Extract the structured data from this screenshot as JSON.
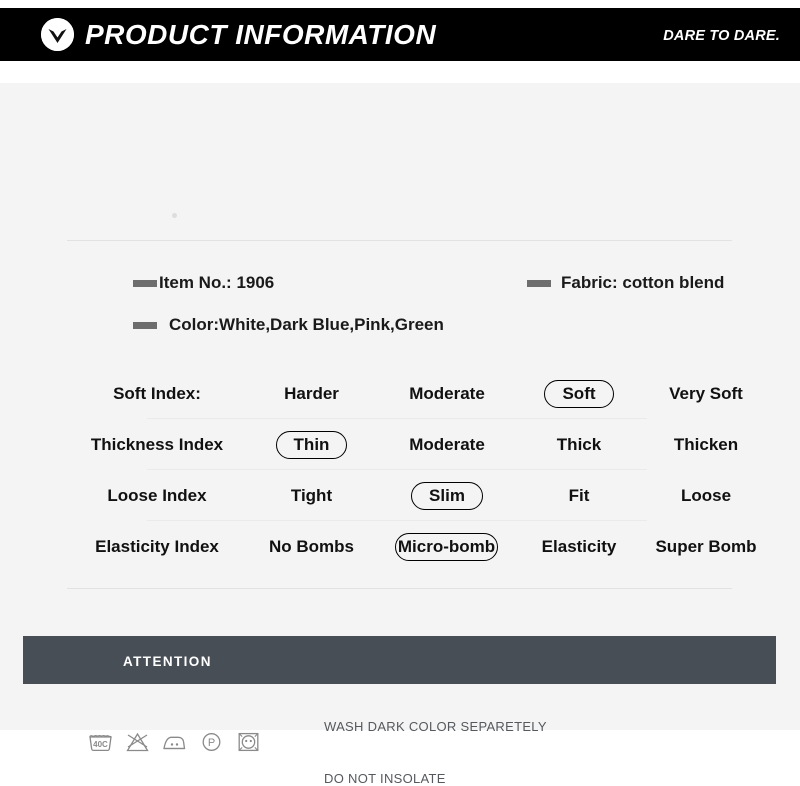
{
  "header": {
    "title": "PRODUCT INFORMATION",
    "tagline": "DARE TO DARE.",
    "logo_icon": "v-chevron-logo-icon",
    "background_color": "#000000",
    "text_color": "#ffffff"
  },
  "meta": {
    "item_no": "Item No.:  1906",
    "fabric": "Fabric:  cotton blend",
    "color": "Color:White,Dark Blue,Pink,Green"
  },
  "index_table": {
    "rows": [
      {
        "label": "Soft Index:",
        "options": [
          "Harder",
          "Moderate",
          "Soft",
          "Very Soft"
        ],
        "selected": "Soft",
        "selected_index": 2
      },
      {
        "label": "Thickness Index",
        "options": [
          "Thin",
          "Moderate",
          "Thick",
          "Thicken"
        ],
        "selected": "Thin",
        "selected_index": 0
      },
      {
        "label": "Loose Index",
        "options": [
          "Tight",
          "Slim",
          "Fit",
          "Loose"
        ],
        "selected": "Slim",
        "selected_index": 1
      },
      {
        "label": "Elasticity Index",
        "options": [
          "No Bombs",
          "Micro-bomb",
          "Elasticity",
          "Super Bomb"
        ],
        "selected": "Micro-bomb",
        "selected_index": 1
      }
    ]
  },
  "attention": {
    "title": "ATTENTION",
    "background_color": "#474e56",
    "care_symbols": [
      {
        "name": "wash-40c-icon",
        "label": "40C"
      },
      {
        "name": "do-not-bleach-icon",
        "label": ""
      },
      {
        "name": "iron-two-dots-icon",
        "label": ""
      },
      {
        "name": "dry-clean-p-icon",
        "label": "P"
      },
      {
        "name": "tumble-dry-icon",
        "label": ""
      }
    ],
    "care_lines": [
      "WASH DARK COLOR SEPARETELY",
      "DO NOT INSOLATE"
    ]
  },
  "colors": {
    "page_background": "#f4f4f4",
    "divider": "#e2e2e2",
    "marker_dash": "#6d6d6d"
  }
}
